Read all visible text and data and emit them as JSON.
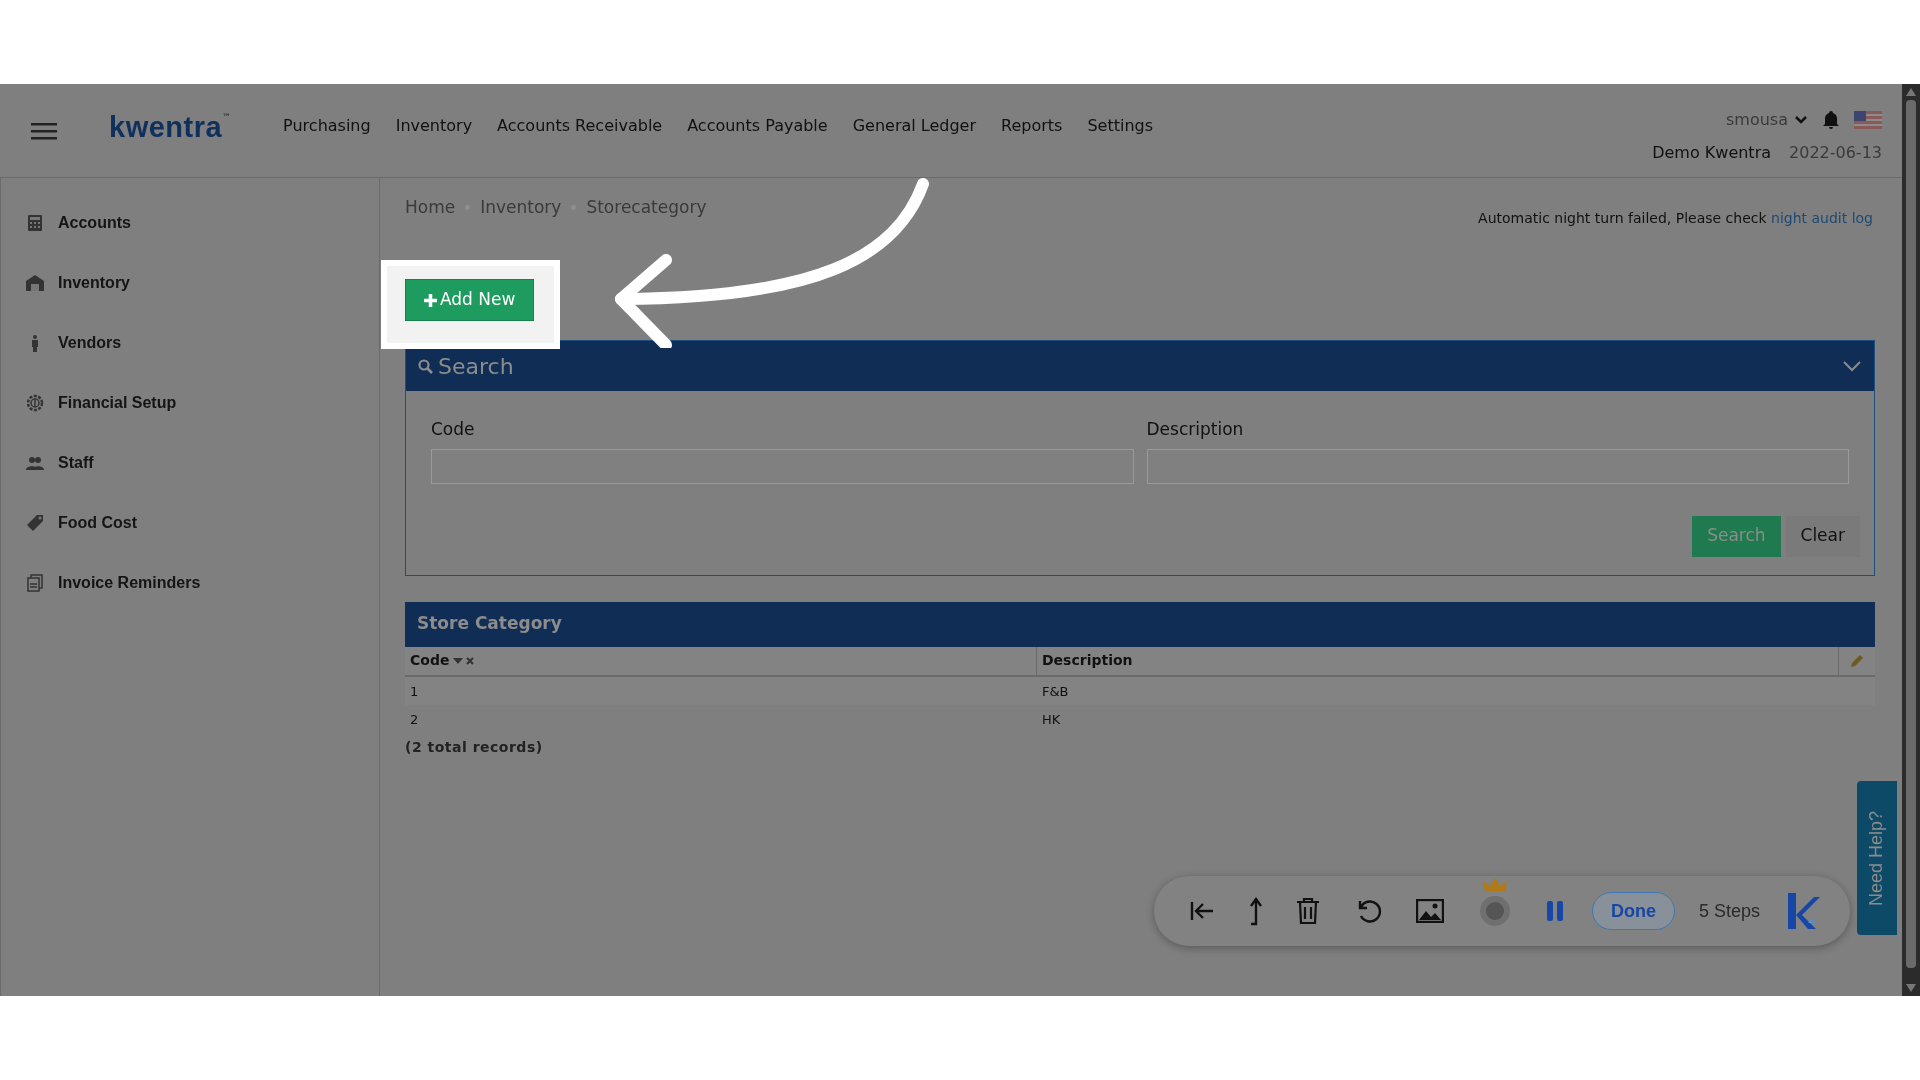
{
  "header": {
    "logo": "kwentra",
    "logo_mark": "™",
    "nav": [
      "Purchasing",
      "Inventory",
      "Accounts Receivable",
      "Accounts Payable",
      "General Ledger",
      "Reports",
      "Settings"
    ],
    "user": "smousa",
    "company": "Demo Kwentra",
    "date": "2022-06-13"
  },
  "sidebar": {
    "items": [
      {
        "label": "Accounts",
        "kind": "calculator"
      },
      {
        "label": "Inventory",
        "kind": "warehouse"
      },
      {
        "label": "Vendors",
        "kind": "person"
      },
      {
        "label": "Financial Setup",
        "kind": "gear"
      },
      {
        "label": "Staff",
        "kind": "people"
      },
      {
        "label": "Food Cost",
        "kind": "tag"
      },
      {
        "label": "Invoice Reminders",
        "kind": "documents"
      }
    ]
  },
  "breadcrumb": [
    "Home",
    "Inventory",
    "Storecategory"
  ],
  "alert": {
    "text": "Automatic night turn failed, Please check",
    "link": "night audit log"
  },
  "add_button": "Add New",
  "search_panel": {
    "title": "Search",
    "fields": [
      {
        "label": "Code"
      },
      {
        "label": "Description"
      }
    ],
    "buttons": [
      {
        "label": "Search",
        "kind": "primary"
      },
      {
        "label": "Clear",
        "kind": "secondary"
      }
    ]
  },
  "table": {
    "title": "Store Category",
    "columns": [
      {
        "label": "Code",
        "sorted": true
      },
      {
        "label": "Description",
        "sorted": false
      }
    ],
    "rows": [
      [
        "1",
        "F&B"
      ],
      [
        "2",
        "HK"
      ]
    ],
    "footer": "(2 total records)"
  },
  "help_tab": "Need Help?",
  "recorder": {
    "done": "Done",
    "steps": "5 Steps"
  }
}
